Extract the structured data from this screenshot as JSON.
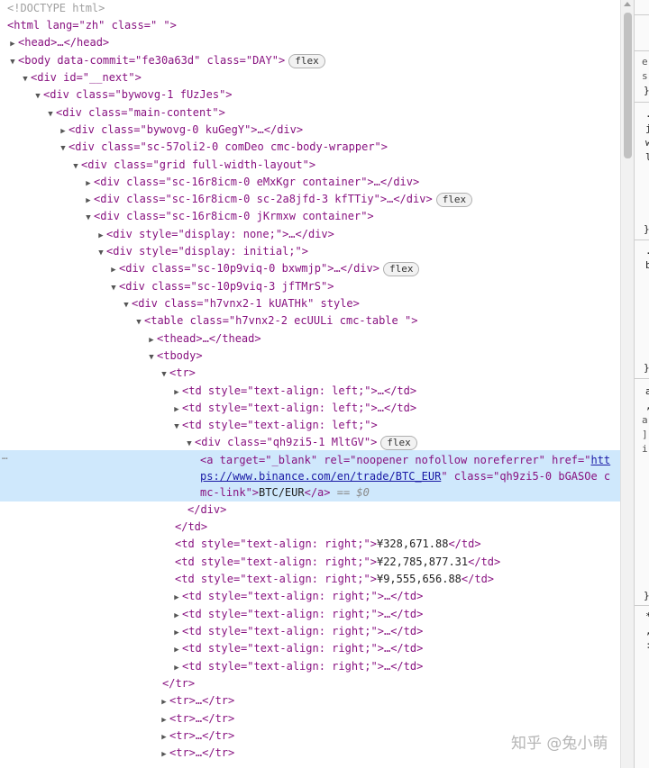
{
  "dom": {
    "doctype": "<!DOCTYPE html>",
    "html_open": "<html lang=\"zh\" class=\" \">",
    "head": "<head>…</head>",
    "body": {
      "open": "<body data-commit=\"fe30a63d\" class=\"DAY\">",
      "badge": "flex"
    },
    "next": "<div id=\"__next\">",
    "bywovg1": "<div class=\"bywovg-1 fUzJes\">",
    "main_content": "<div class=\"main-content\">",
    "bywovg0": "<div class=\"bywovg-0 kuGegY\">…</div>",
    "sc57": "<div class=\"sc-57oli2-0 comDeo cmc-body-wrapper\">",
    "grid": "<div class=\"grid full-width-layout\">",
    "sc16_a": "<div class=\"sc-16r8icm-0 eMxKgr container\">…</div>",
    "sc16_b": {
      "text": "<div class=\"sc-16r8icm-0 sc-2a8jfd-3 kfTTiy\">…</div>",
      "badge": "flex"
    },
    "sc16_c": "<div class=\"sc-16r8icm-0 jKrmxw container\">",
    "style_none": "<div style=\"display: none;\">…</div>",
    "style_initial": "<div style=\"display: initial;\">",
    "sc10_a": {
      "text": "<div class=\"sc-10p9viq-0 bxwmjp\">…</div>",
      "badge": "flex"
    },
    "sc10_b": "<div class=\"sc-10p9viq-3 jfTMrS\">",
    "h7_1": "<div class=\"h7vnx2-1 kUATHk\" style>",
    "table": "<table class=\"h7vnx2-2 ecUULi cmc-table  \">",
    "thead": "<thead>…</thead>",
    "tbody": "<tbody>",
    "tr": "<tr>",
    "td_left_1": "<td style=\"text-align: left;\">…</td>",
    "td_left_2": "<td style=\"text-align: left;\">…</td>",
    "td_left_3": "<td style=\"text-align: left;\">",
    "div_qh": {
      "text": "<div class=\"qh9zi5-1 MltGV\">",
      "badge": "flex"
    },
    "anchor": {
      "line1_pre": "<a target=\"_blank\" rel=\"noopener nofollow noreferrer\" href=\"",
      "href_part1": "htt",
      "href_part2": "ps://www.binance.com/en/trade/BTC_EUR",
      "line2_post": "\" class=\"qh9zi5-0 bGASOe c",
      "line3_pre": "mc-link\">",
      "link_text": "BTC/EUR",
      "close": "</a>",
      "eq": " == $0"
    },
    "div_close": "</div>",
    "td_close": "</td>",
    "td_right_1": {
      "open": "<td style=\"text-align: right;\">",
      "value": "¥328,671.88",
      "close": "</td>"
    },
    "td_right_2": {
      "open": "<td style=\"text-align: right;\">",
      "value": "¥22,785,877.31",
      "close": "</td>"
    },
    "td_right_3": {
      "open": "<td style=\"text-align: right;\">",
      "value": "¥9,555,656.88",
      "close": "</td>"
    },
    "td_right_col": "<td style=\"text-align: right;\">…</td>",
    "tr_close": "</tr>",
    "tr_collapsed": "<tr>…</tr>",
    "ellipsis": "…"
  },
  "side_panel": {
    "chars": [
      "e",
      "s",
      "}",
      ".",
      "j",
      "w",
      "l",
      "}",
      ".",
      "b",
      "}",
      "a",
      ",",
      "a",
      "]",
      "i",
      "}",
      "*",
      ",",
      ":"
    ]
  },
  "watermark": "知乎 @兔小萌"
}
